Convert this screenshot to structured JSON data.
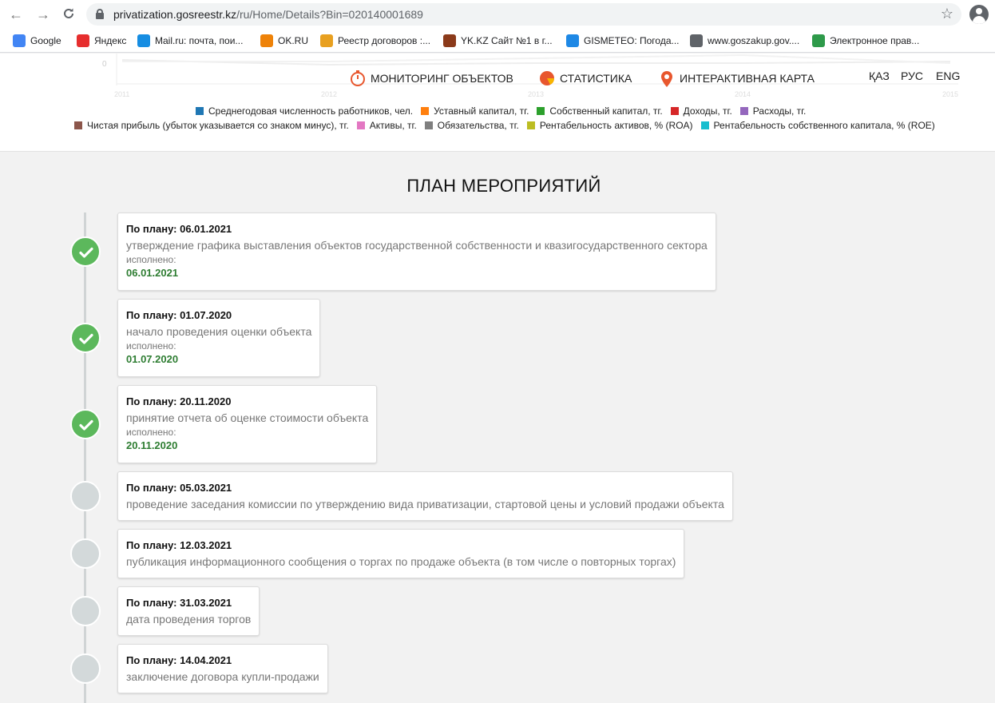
{
  "browser": {
    "url_host": "privatization.gosreestr.kz",
    "url_path": "/ru/Home/Details?Bin=020140001689",
    "bookmarks": [
      {
        "label": "Google",
        "icon": "google-icon",
        "color": "#4285f4"
      },
      {
        "label": "Яндекс",
        "icon": "yandex-icon",
        "color": "#e62e2e"
      },
      {
        "label": "Mail.ru: почта, пои...",
        "icon": "mailru-icon",
        "color": "#168de2"
      },
      {
        "label": "OK.RU",
        "icon": "ok-icon",
        "color": "#ee8208"
      },
      {
        "label": "Реестр договоров :...",
        "icon": "registry-icon",
        "color": "#e8a020"
      },
      {
        "label": "YK.KZ Сайт №1 в г...",
        "icon": "yk-icon",
        "color": "#8b3a1a"
      },
      {
        "label": "GISMETEO: Погода...",
        "icon": "gismeteo-icon",
        "color": "#1e88e5"
      },
      {
        "label": "www.goszakup.gov....",
        "icon": "globe-icon",
        "color": "#5f6368"
      },
      {
        "label": "Электронное прав...",
        "icon": "egov-icon",
        "color": "#2e9a4a"
      }
    ]
  },
  "header": {
    "menu": [
      {
        "label": "МОНИТОРИНГ ОБЪЕКТОВ",
        "icon": "stopwatch-icon"
      },
      {
        "label": "СТАТИСТИКА",
        "icon": "pie-chart-icon"
      },
      {
        "label": "ИНТЕРАКТИВНАЯ КАРТА",
        "icon": "map-pin-icon"
      }
    ],
    "languages": [
      "ҚАЗ",
      "РУС",
      "ENG"
    ],
    "chart_years": [
      "2011",
      "2012",
      "2013",
      "2014",
      "2015"
    ],
    "chart_ytick": "0",
    "legend_row1": [
      {
        "label": "Среднегодовая численность работников, чел.",
        "color": "#1f77b4"
      },
      {
        "label": "Уставный капитал, тг.",
        "color": "#ff7f0e"
      },
      {
        "label": "Собственный капитал, тг.",
        "color": "#2ca02c"
      },
      {
        "label": "Доходы, тг.",
        "color": "#d62728"
      },
      {
        "label": "Расходы, тг.",
        "color": "#9467bd"
      }
    ],
    "legend_row2": [
      {
        "label": "Чистая прибыль (убыток указывается со знаком минус), тг.",
        "color": "#8c564b"
      },
      {
        "label": "Активы, тг.",
        "color": "#e377c2"
      },
      {
        "label": "Обязательства, тг.",
        "color": "#7f7f7f"
      },
      {
        "label": "Рентабельность активов, % (ROA)",
        "color": "#bcbd22"
      },
      {
        "label": "Рентабельность собственного капитала, % (ROE)",
        "color": "#17becf"
      }
    ]
  },
  "plan": {
    "title": "ПЛАН МЕРОПРИЯТИЙ",
    "done_label": "исполнено:",
    "events": [
      {
        "planned": "По плану: 06.01.2021",
        "description": "утверждение графика выставления объектов государственной собственности и квазигосударственного сектора",
        "done": "06.01.2021"
      },
      {
        "planned": "По плану: 01.07.2020",
        "description": "начало проведения оценки объекта",
        "done": "01.07.2020"
      },
      {
        "planned": "По плану: 20.11.2020",
        "description": "принятие отчета об оценке стоимости объекта",
        "done": "20.11.2020"
      },
      {
        "planned": "По плану: 05.03.2021",
        "description": "проведение заседания комиссии по утверждению вида приватизации, стартовой цены и условий продажи объекта",
        "done": null
      },
      {
        "planned": "По плану: 12.03.2021",
        "description": "публикация информационного сообщения о торгах по продаже объекта (в том числе о повторных торгах)",
        "done": null
      },
      {
        "planned": "По плану: 31.03.2021",
        "description": "дата проведения торгов",
        "done": null
      },
      {
        "planned": "По плану: 14.04.2021",
        "description": "заключение договора купли-продажи",
        "done": null
      }
    ]
  }
}
